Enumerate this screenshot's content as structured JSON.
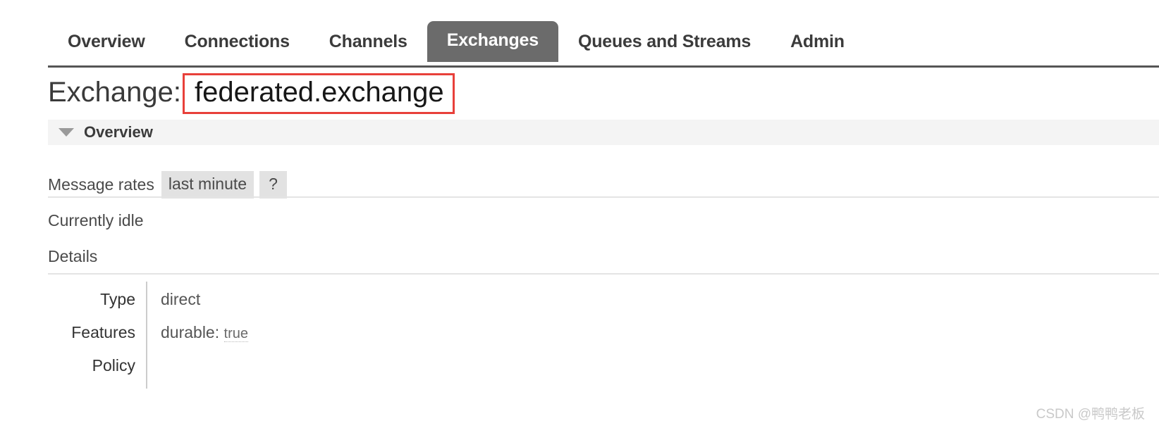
{
  "nav": {
    "active_tab": "Exchanges",
    "active_tab_bg": "#6b6b6b",
    "tabs": [
      {
        "label": "Overview",
        "active": false
      },
      {
        "label": "Connections",
        "active": false
      },
      {
        "label": "Channels",
        "active": false
      },
      {
        "label": "Exchanges",
        "active": true
      },
      {
        "label": "Queues and Streams",
        "active": false
      },
      {
        "label": "Admin",
        "active": false
      }
    ]
  },
  "page": {
    "title_prefix": "Exchange:",
    "exchange_name": "federated.exchange",
    "highlight_color": "#e8403a"
  },
  "overview_section": {
    "label": "Overview",
    "toggle_icon": "chevron-down-icon",
    "expanded": true
  },
  "message_rates": {
    "label": "Message rates",
    "period_chip": "last minute",
    "help_chip": "?",
    "idle_text": "Currently idle"
  },
  "details": {
    "label": "Details",
    "rows": [
      {
        "key": "Type",
        "value": "direct",
        "tooltip_value": ""
      },
      {
        "key": "Features",
        "value": "durable:",
        "tooltip_value": "true"
      },
      {
        "key": "Policy",
        "value": "",
        "tooltip_value": ""
      }
    ]
  },
  "watermark": {
    "text": "CSDN @鸭鸭老板"
  }
}
